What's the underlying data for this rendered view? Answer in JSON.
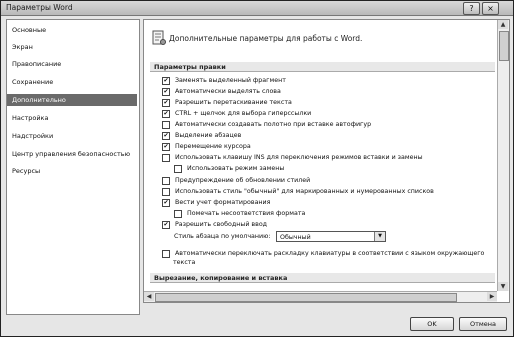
{
  "window": {
    "title": "Параметры Word",
    "help_glyph": "?",
    "close_glyph": "×"
  },
  "sidebar": {
    "items": [
      {
        "label": "Основные"
      },
      {
        "label": "Экран"
      },
      {
        "label": "Правописание"
      },
      {
        "label": "Сохранение"
      },
      {
        "label": "Дополнительно",
        "selected": true
      },
      {
        "label": "Настройка"
      },
      {
        "label": "Надстройки"
      },
      {
        "label": "Центр управления безопасностью"
      },
      {
        "label": "Ресурсы"
      }
    ]
  },
  "content": {
    "header": "Дополнительные параметры для работы с Word.",
    "section_edit": "Параметры правки",
    "options": [
      {
        "label": "Заменять выделенный фрагмент",
        "checked": true
      },
      {
        "label": "Автоматически выделять слова",
        "checked": true
      },
      {
        "label": "Разрешить перетаскивание текста",
        "checked": true
      },
      {
        "label": "CTRL + щелчок для выбора гиперссылки",
        "checked": true
      },
      {
        "label": "Автоматически создавать полотно при вставке автофигур",
        "checked": false
      },
      {
        "label": "Выделение абзацев",
        "checked": true
      },
      {
        "label": "Перемещение курсора",
        "checked": true
      },
      {
        "label": "Использовать клавишу INS для переключения режимов вставки и замены",
        "checked": false
      },
      {
        "label": "Использовать режим замены",
        "checked": false
      },
      {
        "label": "Предупреждение об обновлении стилей",
        "checked": false
      },
      {
        "label": "Использовать стиль \"обычный\" для маркированных и нумерованных списков",
        "checked": false
      },
      {
        "label": "Вести учет форматирования",
        "checked": true
      },
      {
        "label": "Помечать несоответствия формата",
        "checked": false
      },
      {
        "label": "Разрешить свободный ввод",
        "checked": true
      }
    ],
    "default_style_label": "Стиль абзаца по умолчанию:",
    "default_style_value": "Обычный",
    "keyboard_option_line1": "Автоматически переключать раскладку клавиатуры в соответствии с языком окружающего",
    "keyboard_option_line2": "текста",
    "keyboard_option_checked": false,
    "section_cut": "Вырезание, копирование и вставка"
  },
  "buttons": {
    "ok": "OK",
    "cancel": "Отмена"
  },
  "glyphs": {
    "check": "✔",
    "up": "▲",
    "down": "▼",
    "left": "◀",
    "right": "▶",
    "dropdown": "▼"
  }
}
